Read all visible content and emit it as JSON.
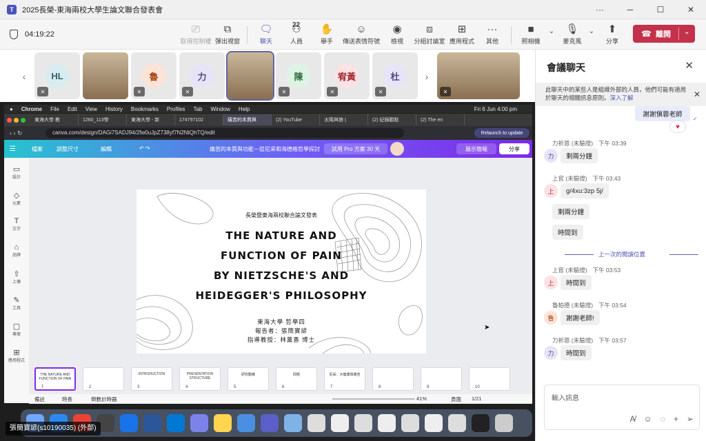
{
  "window": {
    "title": "2025長榮-東海兩校大學生論文聯合發表會",
    "minimize": "─",
    "maximize": "☐",
    "close": "✕",
    "menu": "···"
  },
  "toolbar": {
    "timer": "04:19:22",
    "buttons": {
      "take_control": "取得控制權",
      "popout": "彈出視窗",
      "chat": "聊天",
      "people": "人員",
      "people_count": "22",
      "raise_hand": "舉手",
      "reactions": "傳送表情符號",
      "view": "檢視",
      "rooms": "分組討論室",
      "apps": "應用程式",
      "more": "其他",
      "camera": "照相機",
      "mic": "麥克風",
      "share": "分享",
      "leave": "離開"
    }
  },
  "participants": [
    {
      "initials": "HL",
      "bg": "#d9ecf0",
      "fg": "#2f5f70"
    },
    {
      "initials": "",
      "photo": true
    },
    {
      "initials": "魯",
      "bg": "#fbe3d8",
      "fg": "#a74109"
    },
    {
      "initials": "力",
      "bg": "#e7e4f7",
      "fg": "#4f4a8a"
    },
    {
      "initials": "",
      "photo": true,
      "selected": true
    },
    {
      "initials": "陳",
      "bg": "#dff3e4",
      "fg": "#2d6b3d"
    },
    {
      "initials": "宥黃",
      "bg": "#fbe2e4",
      "fg": "#a4262c"
    },
    {
      "initials": "杜",
      "bg": "#e7e4f7",
      "fg": "#4f4a8a"
    }
  ],
  "shared_screen": {
    "mac_menu": [
      "Chrome",
      "File",
      "Edit",
      "View",
      "History",
      "Bookmarks",
      "Profiles",
      "Tab",
      "Window",
      "Help"
    ],
    "clock": "Fri 6 Jun  4:00 pm",
    "tabs": [
      "東海大學 教",
      "1260_113學",
      "東海大學 - 新",
      "174797102",
      "痛苦的本質與",
      "(2) YouTube",
      "太陽與狼 (",
      "(2) 紀錄觀點",
      "(2) The en"
    ],
    "url": "canva.com/design/DAGi7SADJ94/2fw0uJpZ738yf7N2NtQhTQ/edit",
    "relaunch": "Relaunch to update",
    "canva": {
      "file": "檔案",
      "resize": "調整尺寸",
      "edit": "編輯",
      "doc_title": "痛苦的本質與功能－從尼采和海德格哲學探討",
      "trial": "試用 Pro 方案 30 天",
      "present": "展示簡報",
      "share": "分享",
      "left_items": [
        "設計",
        "元素",
        "文字",
        "品牌",
        "上傳",
        "工具",
        "專案",
        "應用程式"
      ]
    },
    "slide": {
      "header": "長榮暨東海兩校聯合論文發表",
      "title_lines": [
        "THE NATURE AND",
        "FUNCTION OF PAIN",
        "BY NIETZSCHE'S AND",
        "HEIDEGGER'S PHILOSOPHY"
      ],
      "school": "東海大學 哲學四",
      "presenter": "報告者：張簡寶諺",
      "advisor": "指導教授：林薰香 博士"
    },
    "thumbnails": [
      {
        "label": "THE NATURE AND FUNCTION OF PAIN",
        "num": "1"
      },
      {
        "label": "",
        "num": "2"
      },
      {
        "label": "INTRODUCTION",
        "num": "3"
      },
      {
        "label": "PRESENTATION STRUCTURE",
        "num": "4"
      },
      {
        "label": "研究動機",
        "num": "5"
      },
      {
        "label": "問題",
        "num": "6"
      },
      {
        "label": "尼采：大健康與痛苦",
        "num": "7"
      },
      {
        "label": "",
        "num": "8"
      },
      {
        "label": "",
        "num": "9"
      },
      {
        "label": "",
        "num": "10"
      }
    ],
    "status": {
      "notes": "備註",
      "duration": "時長",
      "timer": "倒數計時器",
      "zoom": "41%",
      "pages": "頁面",
      "page_of": "1/21"
    }
  },
  "sharer_name": "張簡寶諺(s10190035) (外部)",
  "chat": {
    "title": "會議聊天",
    "notice": "此聊天中的某些人是組織外部的人員，他們可能有適用於聊天的相關訊息原則。",
    "notice_link": "深入了解",
    "my_message": "謝謝愼蓉老師",
    "messages": [
      {
        "sender": "力祈恩 (未驗證)",
        "time": "下午 03:39",
        "avatar": "力",
        "bg": "#e7e4f7",
        "fg": "#4f4a8a",
        "texts": [
          "剩兩分鐘"
        ]
      },
      {
        "sender": "上官 (未驗證)",
        "time": "下午 03:43",
        "avatar": "上",
        "bg": "#fbe2e4",
        "fg": "#a4262c",
        "texts": [
          "g/4xu:3zp 5j/",
          "剩兩分鐘",
          "時間到"
        ]
      },
      {
        "sender": "上官 (未驗證)",
        "time": "下午 03:53",
        "avatar": "上",
        "bg": "#fbe2e4",
        "fg": "#a4262c",
        "texts": [
          "時間到"
        ]
      },
      {
        "sender": "魯柏德 (未驗證)",
        "time": "下午 03:54",
        "avatar": "魯",
        "bg": "#fbe3d8",
        "fg": "#a74109",
        "texts": [
          "謝謝老師!"
        ]
      },
      {
        "sender": "力祈恩 (未驗證)",
        "time": "下午 03:57",
        "avatar": "力",
        "bg": "#e7e4f7",
        "fg": "#4f4a8a",
        "texts": [
          "時間到"
        ]
      }
    ],
    "last_read": "上一次的閱讀位置",
    "input_placeholder": "輸入訊息"
  }
}
